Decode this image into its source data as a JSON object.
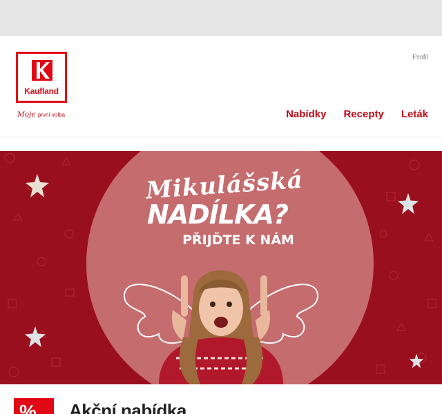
{
  "header": {
    "logo_text": "Kaufland",
    "slogan_script": "Moje",
    "slogan_rest": "první volba",
    "profile_label": "Profil",
    "nav": [
      {
        "label": "Nabídky"
      },
      {
        "label": "Recepty"
      },
      {
        "label": "Leták"
      }
    ]
  },
  "hero": {
    "script_line": "Mikulášská",
    "title_line": "NADÍLKA?",
    "sub_line": "PŘIJĎTE K NÁM",
    "colors": {
      "background": "#9a0f1d",
      "circle": "#c56c6f"
    }
  },
  "offers": {
    "icon_label": "%",
    "title": "Akční nabídka"
  },
  "colors": {
    "brand_red": "#e10915",
    "nav_red": "#c10b17"
  }
}
